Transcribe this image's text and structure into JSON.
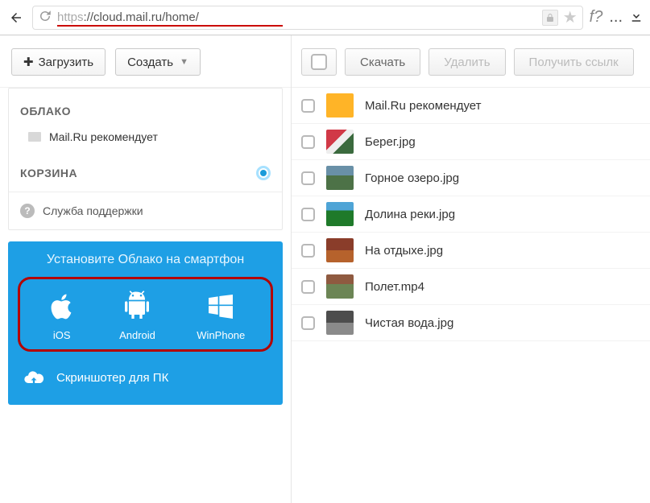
{
  "browser": {
    "url_scheme": "https",
    "url_rest": "://cloud.mail.ru/home/",
    "f_label": "f?",
    "dots": "...",
    "back_icon": "←"
  },
  "sidebar": {
    "upload_label": "Загрузить",
    "create_label": "Создать",
    "cloud_title": "ОБЛАКО",
    "cloud_item": "Mail.Ru рекомендует",
    "trash_title": "КОРЗИНА",
    "support_label": "Служба поддержки"
  },
  "promo": {
    "title": "Установите Облако на смартфон",
    "ios": "iOS",
    "android": "Android",
    "winphone": "WinPhone",
    "screenshoter": "Скриншотер для ПК"
  },
  "fa_toolbar": {
    "download": "Скачать",
    "delete": "Удалить",
    "share": "Получить ссылк"
  },
  "files": [
    {
      "name": "Mail.Ru рекомендует",
      "thumb": "folder"
    },
    {
      "name": "Берег.jpg",
      "thumb": "img1"
    },
    {
      "name": "Горное озеро.jpg",
      "thumb": "img2"
    },
    {
      "name": "Долина реки.jpg",
      "thumb": "img3"
    },
    {
      "name": "На отдыхе.jpg",
      "thumb": "img4"
    },
    {
      "name": "Полет.mp4",
      "thumb": "vid"
    },
    {
      "name": "Чистая вода.jpg",
      "thumb": "img5"
    }
  ]
}
